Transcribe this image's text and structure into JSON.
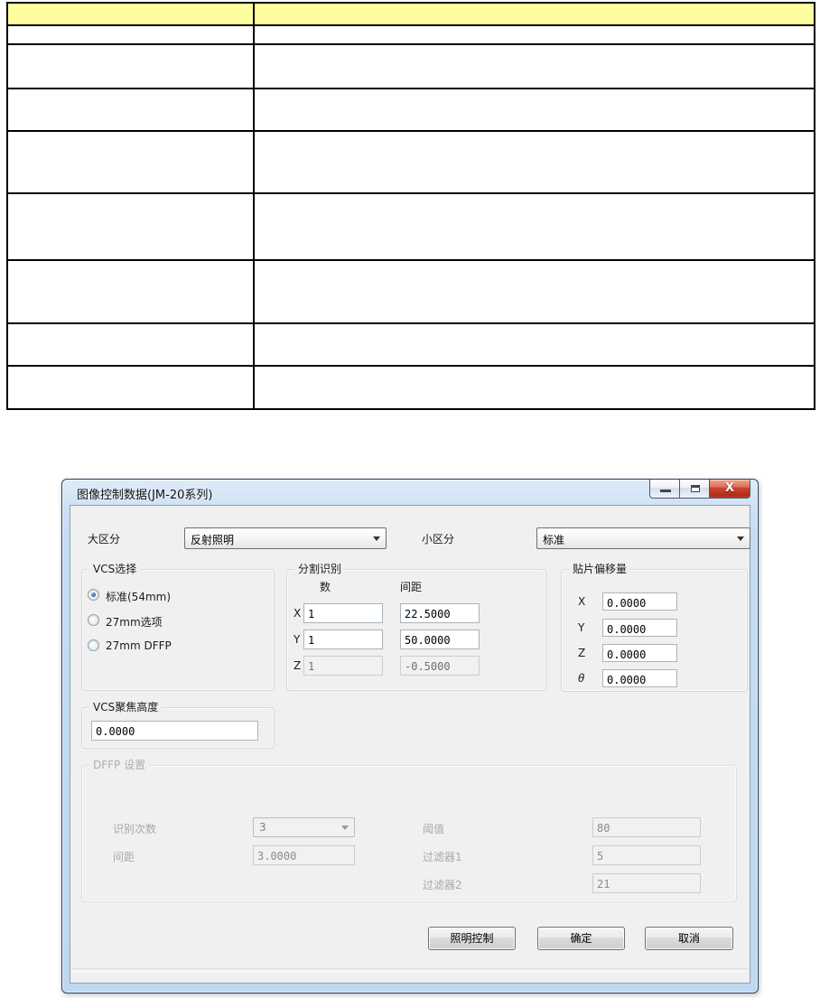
{
  "table": {
    "header_bg": "#fdfd9e",
    "header": [
      "",
      ""
    ],
    "rows": [
      [
        "",
        ""
      ],
      [
        "",
        ""
      ],
      [
        "",
        ""
      ],
      [
        "",
        ""
      ],
      [
        "",
        ""
      ],
      [
        "",
        ""
      ],
      [
        "",
        ""
      ],
      [
        "",
        ""
      ]
    ]
  },
  "dialog": {
    "title": "图像控制数据(JM-20系列)",
    "window_buttons": {
      "minimize": "minimize",
      "maximize": "maximize",
      "close": "close"
    },
    "category_row": {
      "major_label": "大区分",
      "major_value": "反射照明",
      "minor_label": "小区分",
      "minor_value": "标准"
    },
    "vcs_group": {
      "title": "VCS选择",
      "options": [
        {
          "label": "标准(54mm)",
          "selected": true
        },
        {
          "label": "27mm选项",
          "selected": false
        },
        {
          "label": "27mm DFFP",
          "selected": false
        }
      ]
    },
    "split_group": {
      "title": "分割识别",
      "col_count": "数",
      "col_pitch": "间距",
      "rows": [
        {
          "axis": "X",
          "count": "1",
          "pitch": "22.5000",
          "disabled": false
        },
        {
          "axis": "Y",
          "count": "1",
          "pitch": "50.0000",
          "disabled": false
        },
        {
          "axis": "Z",
          "count": "1",
          "pitch": "-0.5000",
          "disabled": true
        }
      ]
    },
    "offset_group": {
      "title": "贴片偏移量",
      "rows": [
        {
          "axis": "X",
          "value": "0.0000"
        },
        {
          "axis": "Y",
          "value": "0.0000"
        },
        {
          "axis": "Z",
          "value": "0.0000"
        },
        {
          "axis": "θ",
          "value": "0.0000"
        }
      ]
    },
    "focus_group": {
      "title": "VCS聚焦高度",
      "value": "0.0000"
    },
    "dffp_group": {
      "title": "DFFP 设置",
      "recog_label": "识别次数",
      "recog_value": "3",
      "pitch_label": "间距",
      "pitch_value": "3.0000",
      "threshold_label": "阈值",
      "threshold_value": "80",
      "filter1_label": "过滤器1",
      "filter1_value": "5",
      "filter2_label": "过滤器2",
      "filter2_value": "21"
    },
    "buttons": {
      "lighting": "照明控制",
      "ok": "确定",
      "cancel": "取消"
    },
    "colors": {
      "client_bg": "#f0f0f0",
      "frame_blue": "#c6dcf3",
      "close_red": "#cc4532",
      "table_header_yellow": "#fdfd9e"
    }
  }
}
